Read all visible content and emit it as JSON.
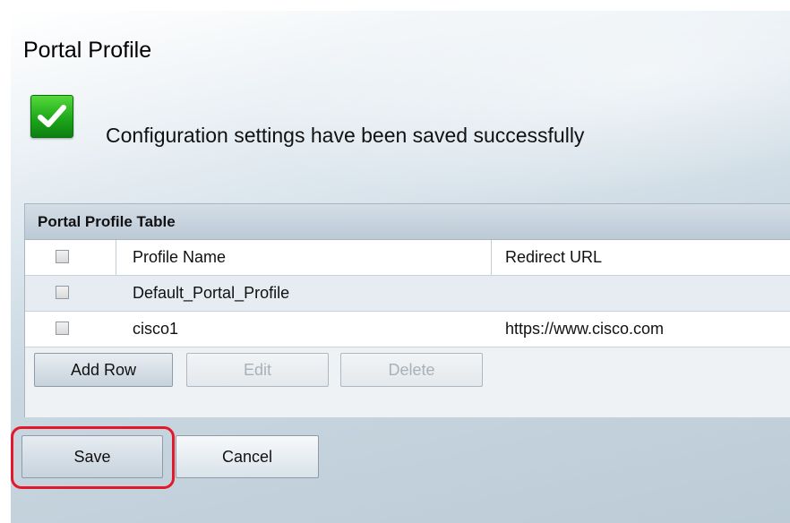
{
  "page": {
    "title": "Portal Profile",
    "status_icon": "success-check-icon",
    "status_message": "Configuration settings have been saved successfully",
    "colors": {
      "success_green": "#1ea81a",
      "highlight_red": "#e3182a"
    }
  },
  "table": {
    "caption": "Portal Profile Table",
    "columns": [
      "",
      "Profile Name",
      "Redirect URL"
    ],
    "rows": [
      {
        "name": "Default_Portal_Profile",
        "url": ""
      },
      {
        "name": "cisco1",
        "url": "https://www.cisco.com"
      }
    ],
    "buttons": {
      "add": "Add Row",
      "edit": "Edit",
      "delete": "Delete"
    }
  },
  "actions": {
    "save": "Save",
    "cancel": "Cancel"
  }
}
